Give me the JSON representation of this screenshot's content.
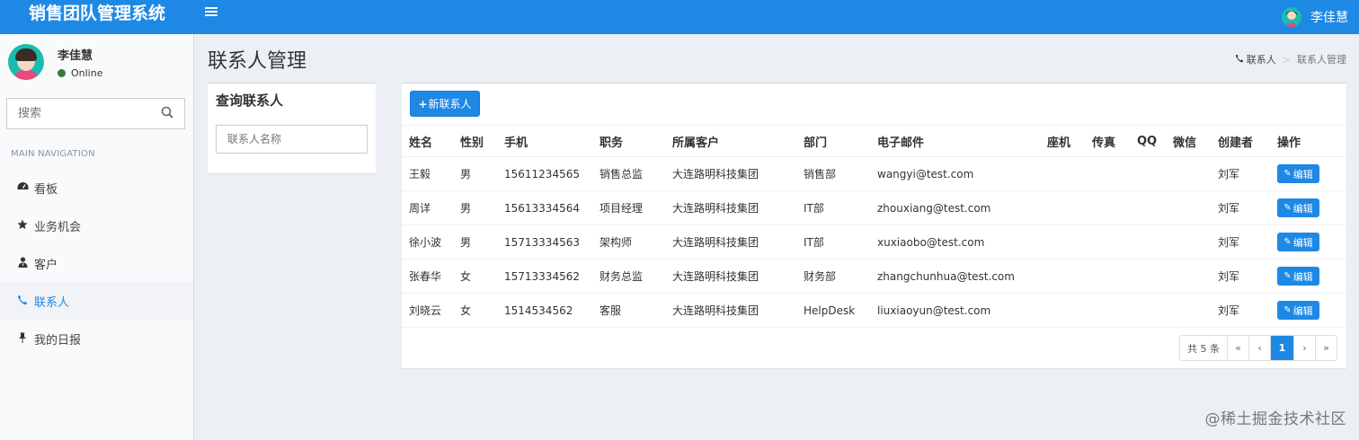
{
  "app": {
    "brand": "销售团队管理系统",
    "menu_icon": "hamburger-icon"
  },
  "topbar_user": {
    "name": "李佳慧"
  },
  "user_panel": {
    "name": "李佳慧",
    "status": "Online",
    "status_color": "#3c763d"
  },
  "sidebar": {
    "search_placeholder": "搜索",
    "nav_header": "MAIN NAVIGATION",
    "items": [
      {
        "label": "看板",
        "icon": "dashboard-icon",
        "active": false
      },
      {
        "label": "业务机会",
        "icon": "star-icon",
        "active": false
      },
      {
        "label": "客户",
        "icon": "user-tie-icon",
        "active": false
      },
      {
        "label": "联系人",
        "icon": "phone-icon",
        "active": true
      },
      {
        "label": "我的日报",
        "icon": "pin-icon",
        "active": false
      }
    ]
  },
  "page": {
    "title": "联系人管理",
    "breadcrumb": [
      {
        "label": "联系人",
        "icon": "phone-icon"
      },
      {
        "label": "联系人管理"
      }
    ]
  },
  "query_box": {
    "title": "查询联系人",
    "input_placeholder": "联系人名称"
  },
  "toolbar": {
    "new_label": "新联系人"
  },
  "table": {
    "columns": [
      "姓名",
      "性别",
      "手机",
      "职务",
      "所属客户",
      "部门",
      "电子邮件",
      "座机",
      "传真",
      "QQ",
      "微信",
      "创建者",
      "操作"
    ],
    "rows": [
      [
        "王毅",
        "男",
        "15611234565",
        "销售总监",
        "大连路明科技集团",
        "销售部",
        "wangyi@test.com",
        "",
        "",
        "",
        "",
        "刘军"
      ],
      [
        "周详",
        "男",
        "15613334564",
        "项目经理",
        "大连路明科技集团",
        "IT部",
        "zhouxiang@test.com",
        "",
        "",
        "",
        "",
        "刘军"
      ],
      [
        "徐小波",
        "男",
        "15713334563",
        "架构师",
        "大连路明科技集团",
        "IT部",
        "xuxiaobo@test.com",
        "",
        "",
        "",
        "",
        "刘军"
      ],
      [
        "张春华",
        "女",
        "15713334562",
        "财务总监",
        "大连路明科技集团",
        "财务部",
        "zhangchunhua@test.com",
        "",
        "",
        "",
        "",
        "刘军"
      ],
      [
        "刘晓云",
        "女",
        "1514534562",
        "客服",
        "大连路明科技集团",
        "HelpDesk",
        "liuxiaoyun@test.com",
        "",
        "",
        "",
        "",
        "刘军"
      ]
    ],
    "edit_label": "编辑"
  },
  "pagination": {
    "total": "共 5 条",
    "first": "«",
    "prev": "‹",
    "current": "1",
    "next": "›",
    "last": "»"
  },
  "watermark": "@稀土掘金技术社区",
  "colors": {
    "primary": "#1e88e5",
    "sidebar_bg": "#f9fafc",
    "content_bg": "#ecf0f5"
  }
}
